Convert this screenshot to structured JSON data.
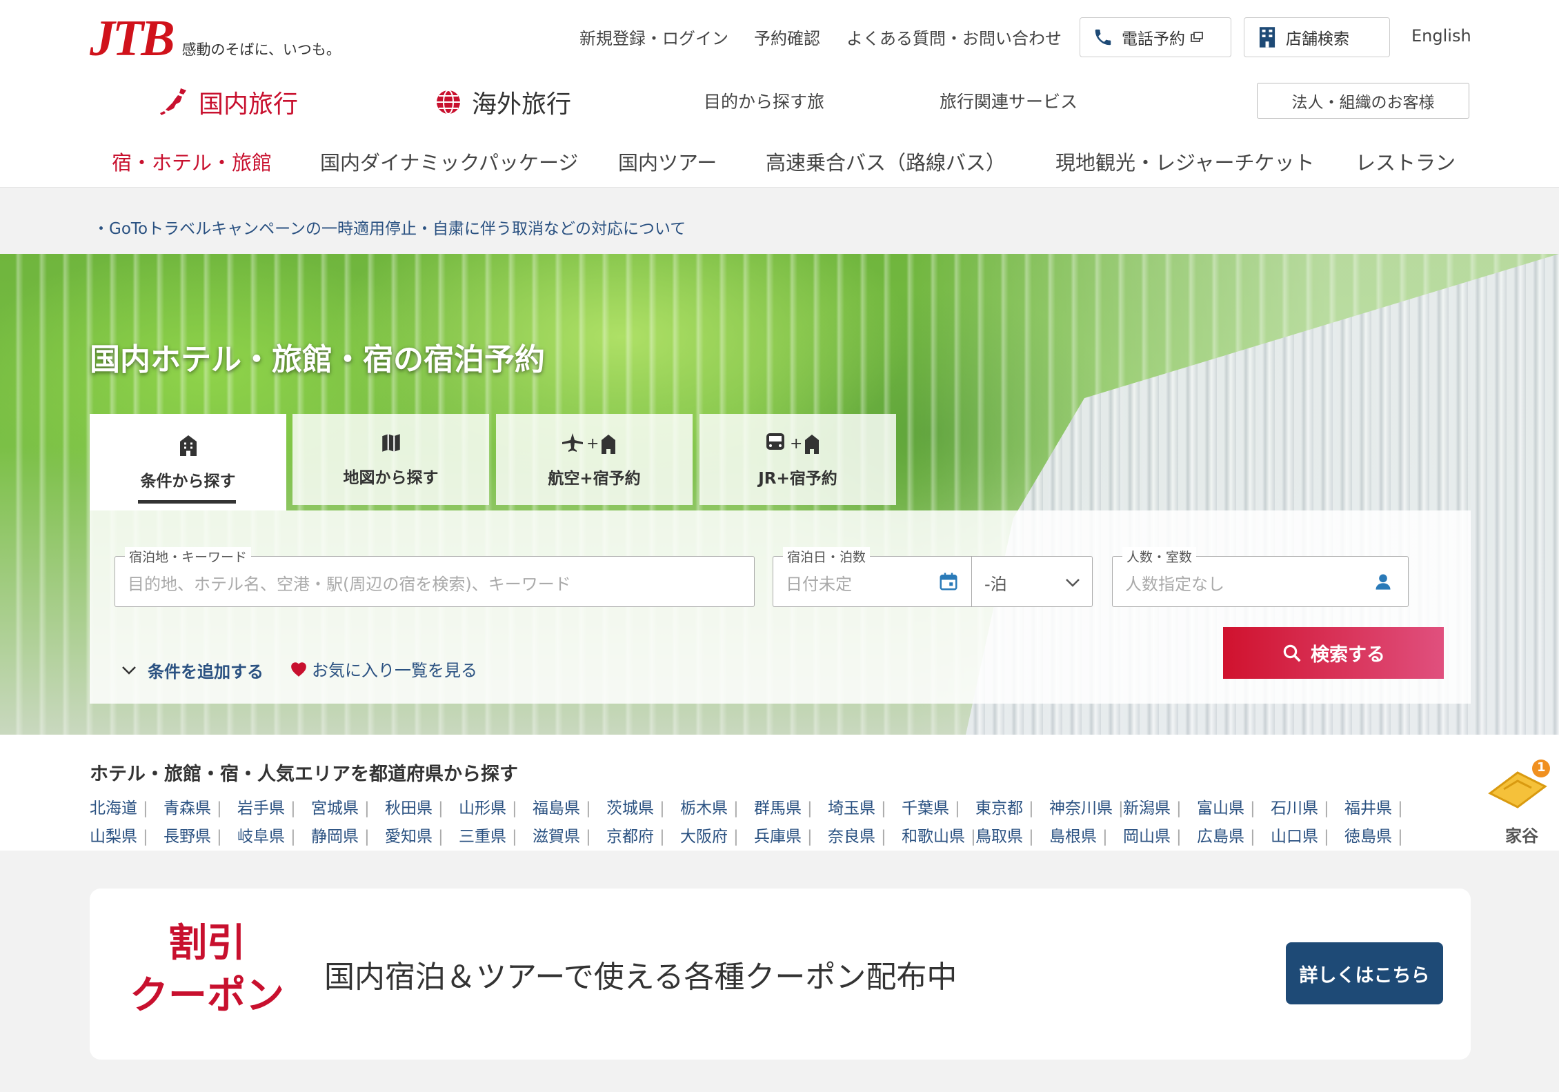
{
  "header": {
    "logo_text": "JTB",
    "tagline": "感動のそばに、いつも。",
    "utility": {
      "register": "新規登録・ログイン",
      "reservation": "予約確認",
      "faq": "よくある質問・お問い合わせ",
      "phone": "電話予約",
      "store": "店舗検索",
      "english": "English"
    },
    "domestic": "国内旅行",
    "overseas": "海外旅行",
    "purpose": "目的から探す旅",
    "services": "旅行関連サービス",
    "corporate": "法人・組織のお客様",
    "nav": [
      "宿・ホテル・旅館",
      "国内ダイナミックパッケージ",
      "国内ツアー",
      "高速乗合バス（路線バス）",
      "現地観光・レジャーチケット",
      "レストラン"
    ]
  },
  "notice": "・GoToトラベルキャンペーンの一時適用停止・自粛に伴う取消などの対応について",
  "hero": {
    "title": "国内ホテル・旅館・宿の宿泊予約",
    "tabs": [
      "条件から探す",
      "地図から探す",
      "航空+宿予約",
      "JR+宿予約"
    ],
    "keyword_label": "宿泊地・キーワード",
    "keyword_placeholder": "目的地、ホテル名、空港・駅(周辺の宿を検索)、キーワード",
    "date_label": "宿泊日・泊数",
    "date_placeholder": "日付未定",
    "nights_value": "-泊",
    "people_label": "人数・室数",
    "people_placeholder": "人数指定なし",
    "add_conditions": "条件を追加する",
    "favorites": "お気に入り一覧を見る",
    "search_button": "検索する"
  },
  "prefectures": {
    "title": "ホテル・旅館・宿・人気エリアを都道府県から探す",
    "row1": [
      "北海道",
      "青森県",
      "岩手県",
      "宮城県",
      "秋田県",
      "山形県",
      "福島県",
      "茨城県",
      "栃木県",
      "群馬県",
      "埼玉県",
      "千葉県",
      "東京都",
      "神奈川県",
      "新潟県",
      "富山県",
      "石川県",
      "福井県"
    ],
    "row2": [
      "山梨県",
      "長野県",
      "岐阜県",
      "静岡県",
      "愛知県",
      "三重県",
      "滋賀県",
      "京都府",
      "大阪府",
      "兵庫県",
      "奈良県",
      "和歌山県",
      "鳥取県",
      "島根県",
      "岡山県",
      "広島県",
      "山口県",
      "徳島県"
    ]
  },
  "cart": {
    "badge": "1",
    "label": "家谷"
  },
  "coupon": {
    "tag_line1": "割引",
    "tag_line2": "クーポン",
    "text": "国内宿泊＆ツアーで使える各種クーポン配布中",
    "button": "詳しくはこちら"
  },
  "colors": {
    "brand_red": "#c8102e",
    "link_blue": "#2a5181",
    "navy": "#1e4a76"
  }
}
